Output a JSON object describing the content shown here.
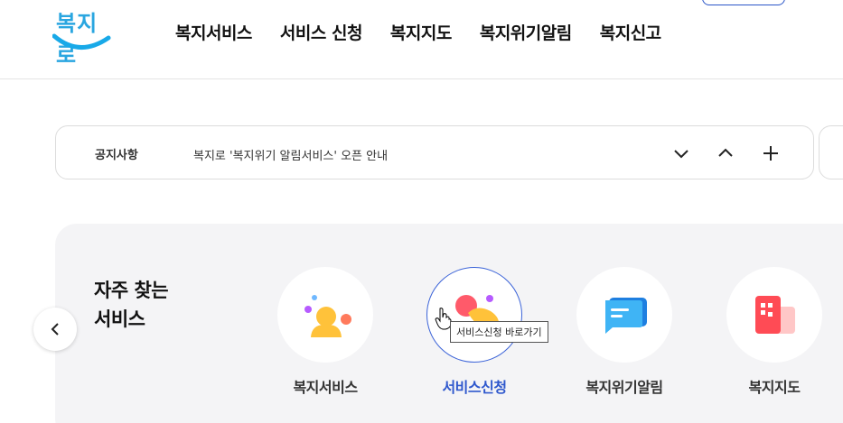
{
  "header": {
    "logo_text": "복지로",
    "nav": [
      {
        "label": "복지서비스"
      },
      {
        "label": "서비스 신청"
      },
      {
        "label": "복지지도"
      },
      {
        "label": "복지위기알림"
      },
      {
        "label": "복지신고"
      }
    ]
  },
  "notice": {
    "label": "공지사항",
    "text": "복지로 '복지위기 알림서비스' 오픈 안내",
    "controls": {
      "down_icon": "chevron-down-icon",
      "up_icon": "chevron-up-icon",
      "add_icon": "plus-icon"
    }
  },
  "frequent": {
    "title_line1": "자주 찾는",
    "title_line2": "서비스",
    "prev_icon": "chevron-left-icon",
    "items": [
      {
        "label": "복지서비스",
        "icon": "person-icon",
        "active": false
      },
      {
        "label": "서비스신청",
        "icon": "hand-tap-icon",
        "active": true
      },
      {
        "label": "복지위기알림",
        "icon": "chat-bubble-icon",
        "active": false
      },
      {
        "label": "복지지도",
        "icon": "map-blocks-icon",
        "active": false
      }
    ]
  },
  "tooltip": {
    "text": "서비스신청 바로가기"
  },
  "colors": {
    "brand": "#2aa6e0",
    "accent": "#2f58cd",
    "panel_bg": "#f4f4f6"
  }
}
